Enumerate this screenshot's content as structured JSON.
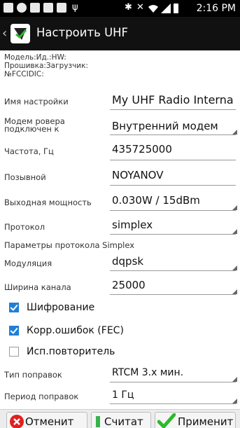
{
  "status_bar": {
    "time": "2:16 PM",
    "icons": [
      "chat-icon",
      "s-icon",
      "f-icon",
      "f-icon",
      "f-icon",
      "usb-icon",
      "bluetooth-icon",
      "mute-icon",
      "wifi-icon",
      "signal-icon",
      "battery-icon"
    ]
  },
  "action_bar": {
    "title": "Настроить UHF"
  },
  "info": {
    "model": "Модель:Ид.:HW:",
    "firmware": "Прошивка:Загрузчик:",
    "fcc": "№FCCIDIC:"
  },
  "fields": {
    "setting_name": {
      "label": "Имя настройки",
      "value": "My UHF Radio Interna"
    },
    "rover_modem": {
      "label": "Модем ровера подключен к",
      "value": "Внутренний модем"
    },
    "frequency": {
      "label": "Частота, Гц",
      "value": "435725000"
    },
    "callsign": {
      "label": "Позывной",
      "value": "NOYANOV"
    },
    "output_power": {
      "label": "Выходная мощность",
      "value": "0.030W / 15dBm"
    },
    "protocol": {
      "label": "Протокол",
      "value": "simplex"
    },
    "protocol_params_header": "Параметры протокола Simplex",
    "modulation": {
      "label": "Модуляция",
      "value": "dqpsk"
    },
    "channel_width": {
      "label": "Ширина канала",
      "value": "25000"
    },
    "correction_type": {
      "label": "Тип поправок",
      "value": "RTCM 3.x мин."
    },
    "correction_period": {
      "label": "Период поправок",
      "value": "1 Гц"
    }
  },
  "checkboxes": {
    "encryption": {
      "label": "Шифрование",
      "checked": true
    },
    "fec": {
      "label": "Корр.ошибок (FEC)",
      "checked": true
    },
    "repeater": {
      "label": "Исп.повторитель",
      "checked": false
    }
  },
  "buttons": {
    "cancel": "Отменит",
    "read": "Считат",
    "apply": "Применит"
  },
  "colors": {
    "checkbox_checked": "#1f7fd6",
    "cancel_icon": "#e02020",
    "apply_icon": "#2fb82f",
    "read_icon": "#37b24d"
  }
}
